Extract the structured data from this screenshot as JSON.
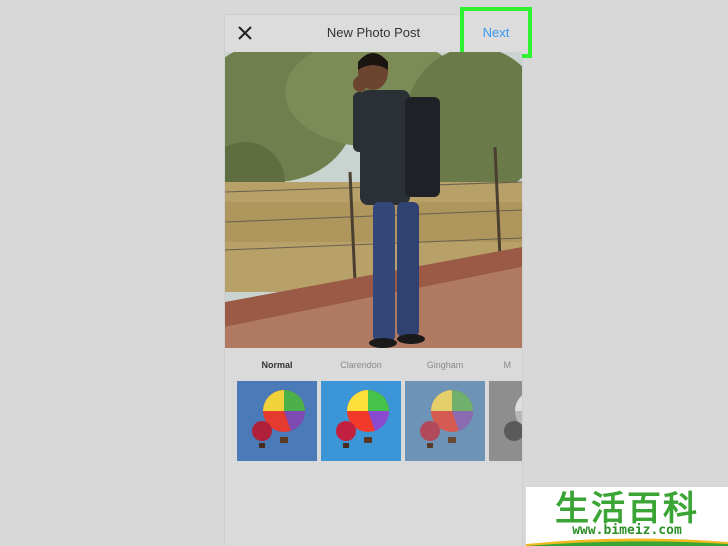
{
  "header": {
    "title": "New Photo Post",
    "next_label": "Next"
  },
  "filters": [
    {
      "label": "Normal",
      "active": true
    },
    {
      "label": "Clarendon",
      "active": false
    },
    {
      "label": "Gingham",
      "active": false
    },
    {
      "label": "M",
      "active": false
    }
  ],
  "watermark": {
    "chinese": "生活百科",
    "url": "www.bimeiz.com"
  },
  "colors": {
    "accent": "#3897f0",
    "highlight": "#2ff12f"
  }
}
